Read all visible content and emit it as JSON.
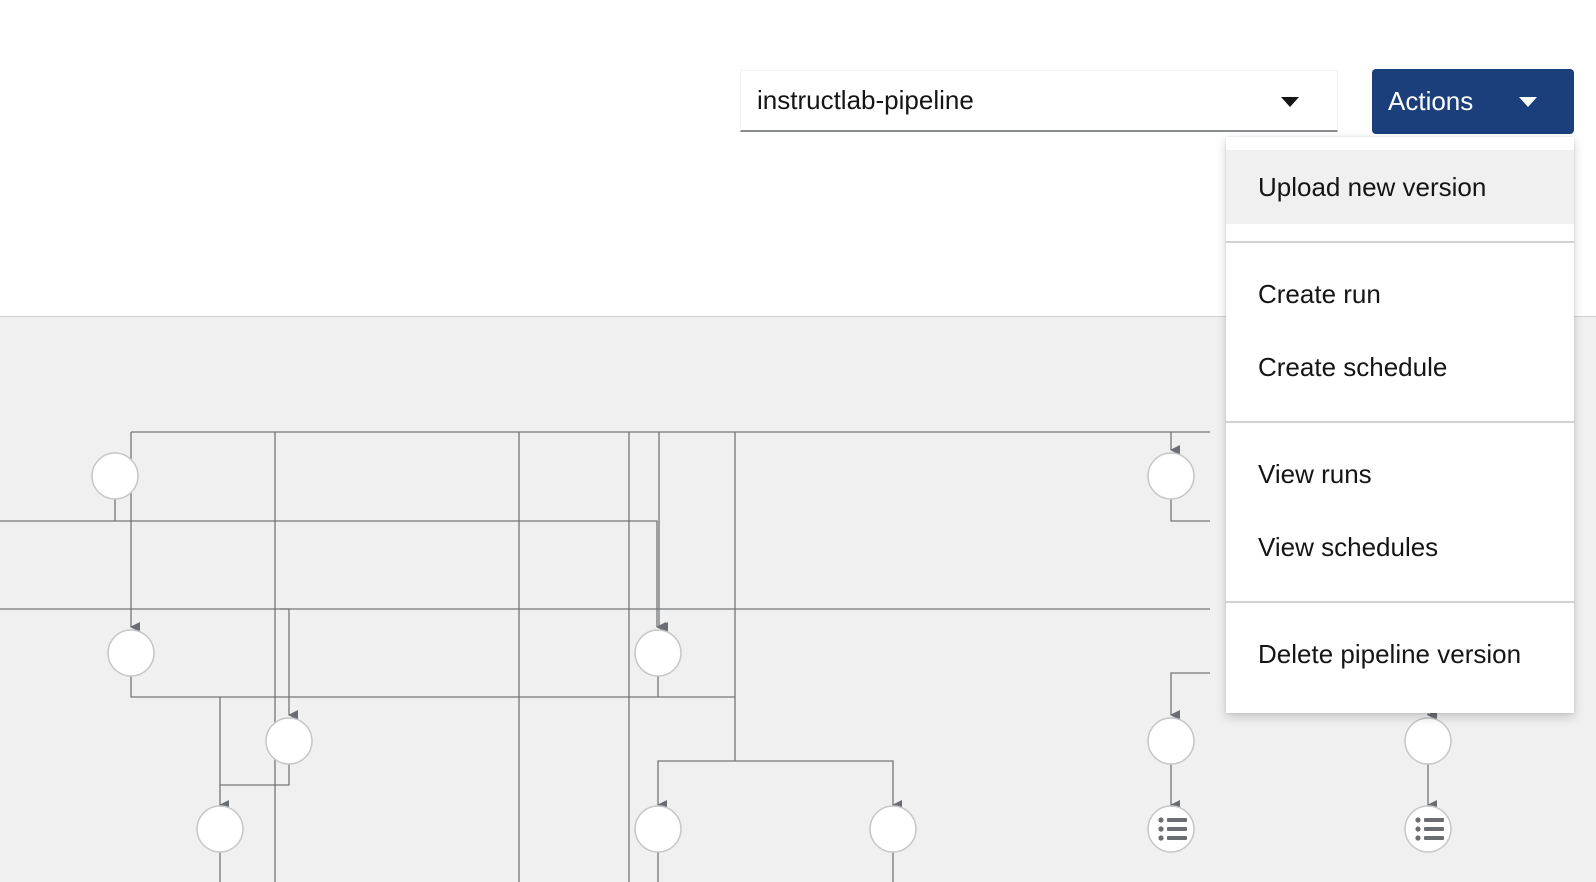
{
  "version_select": {
    "value": "instructlab-pipeline",
    "icon": "caret-down-icon"
  },
  "actions": {
    "label": "Actions",
    "icon": "caret-down-icon",
    "menu": {
      "upload": "Upload new version",
      "create_run": "Create run",
      "create_schedule": "Create schedule",
      "view_runs": "View runs",
      "view_schedules": "View schedules",
      "delete_version": "Delete pipeline version"
    },
    "highlighted_item": "Upload new version"
  },
  "graph": {
    "node_icon": "list-icon"
  },
  "colors": {
    "accent": "#1b3f7a",
    "canvas": "#f0f0f0",
    "edge": "#737679",
    "node_border": "#c7c7c7"
  }
}
